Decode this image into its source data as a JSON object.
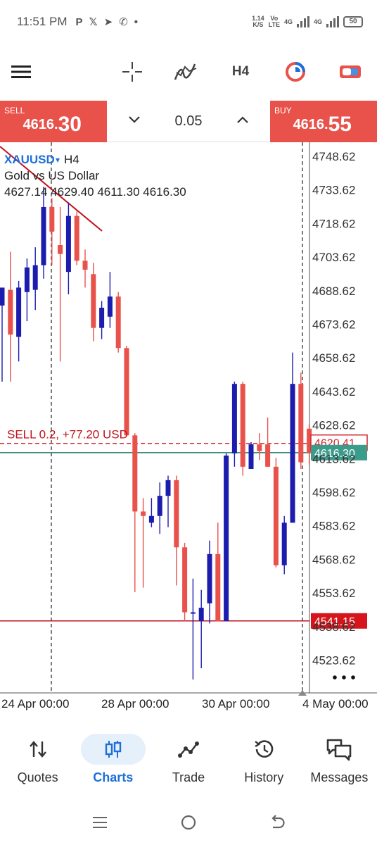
{
  "status_bar": {
    "time": "11:51 PM",
    "speed_value": "1.14",
    "speed_unit": "K/S",
    "vo": "Vo",
    "lte": "LTE",
    "net1": "4G",
    "net2": "4G",
    "battery": "50"
  },
  "toolbar": {
    "timeframe": "H4"
  },
  "trade": {
    "sell_label": "SELL",
    "sell_price_main": "4616.",
    "sell_price_big": "30",
    "buy_label": "BUY",
    "buy_price_main": "4616.",
    "buy_price_big": "55",
    "lot": "0.05"
  },
  "chart_data": {
    "type": "candlestick",
    "symbol": "XAUUSD",
    "timeframe": "H4",
    "description": "Gold vs US Dollar",
    "ohlc_text": "4627.14 4629.40 4611.30 4616.30",
    "y_ticks": [
      "4748.62",
      "4733.62",
      "4718.62",
      "4703.62",
      "4688.62",
      "4673.62",
      "4658.62",
      "4643.62",
      "4628.62",
      "4613.62",
      "4598.62",
      "4583.62",
      "4568.62",
      "4553.62",
      "4538.62",
      "4523.62"
    ],
    "y_range": [
      4514,
      4751
    ],
    "x_labels": [
      "24 Apr 00:00",
      "28 Apr 00:00",
      "30 Apr 00:00",
      "4 May 00:00"
    ],
    "position_label": "SELL 0.2,   +77.20 USD",
    "position_price": 4620.41,
    "position_price_label": "4620.41",
    "current_price": 4616.3,
    "current_price_label": "4616.30",
    "stop_price": 4541.15,
    "stop_price_label": "4541.15",
    "bull_color": "#1c1cae",
    "bear_color": "#e8524a",
    "candles": [
      {
        "o": 4682,
        "h": 4689,
        "l": 4648,
        "c": 4690
      },
      {
        "o": 4689,
        "h": 4706,
        "l": 4648,
        "c": 4669
      },
      {
        "o": 4668,
        "h": 4693,
        "l": 4657,
        "c": 4690
      },
      {
        "o": 4688,
        "h": 4703,
        "l": 4675,
        "c": 4699
      },
      {
        "o": 4689,
        "h": 4708,
        "l": 4680,
        "c": 4700
      },
      {
        "o": 4700,
        "h": 4735,
        "l": 4694,
        "c": 4726
      },
      {
        "o": 4726,
        "h": 4730,
        "l": 4700,
        "c": 4715
      },
      {
        "o": 4709,
        "h": 4726,
        "l": 4657,
        "c": 4705
      },
      {
        "o": 4697,
        "h": 4728,
        "l": 4687,
        "c": 4722
      },
      {
        "o": 4722,
        "h": 4724,
        "l": 4700,
        "c": 4702
      },
      {
        "o": 4702,
        "h": 4707,
        "l": 4690,
        "c": 4698
      },
      {
        "o": 4696,
        "h": 4701,
        "l": 4666,
        "c": 4672
      },
      {
        "o": 4672,
        "h": 4684,
        "l": 4667,
        "c": 4681
      },
      {
        "o": 4677,
        "h": 4697,
        "l": 4672,
        "c": 4686
      },
      {
        "o": 4686,
        "h": 4688,
        "l": 4661,
        "c": 4663
      },
      {
        "o": 4663,
        "h": 4664,
        "l": 4624,
        "c": 4624
      },
      {
        "o": 4624,
        "h": 4625,
        "l": 4554,
        "c": 4590
      },
      {
        "o": 4590,
        "h": 4596,
        "l": 4556,
        "c": 4588
      },
      {
        "o": 4585,
        "h": 4596,
        "l": 4583,
        "c": 4588
      },
      {
        "o": 4588,
        "h": 4603,
        "l": 4580,
        "c": 4597
      },
      {
        "o": 4597,
        "h": 4606,
        "l": 4583,
        "c": 4604
      },
      {
        "o": 4604,
        "h": 4606,
        "l": 4557,
        "c": 4574
      },
      {
        "o": 4574,
        "h": 4576,
        "l": 4541,
        "c": 4545
      },
      {
        "o": 4545,
        "h": 4560,
        "l": 4515,
        "c": 4545
      },
      {
        "o": 4541,
        "h": 4555,
        "l": 4520,
        "c": 4547
      },
      {
        "o": 4549,
        "h": 4577,
        "l": 4540,
        "c": 4571
      },
      {
        "o": 4571,
        "h": 4585,
        "l": 4541,
        "c": 4541
      },
      {
        "o": 4541,
        "h": 4616,
        "l": 4541,
        "c": 4615
      },
      {
        "o": 4616,
        "h": 4648,
        "l": 4610,
        "c": 4647
      },
      {
        "o": 4647,
        "h": 4648,
        "l": 4606,
        "c": 4610
      },
      {
        "o": 4609,
        "h": 4621,
        "l": 4609,
        "c": 4620
      },
      {
        "o": 4620,
        "h": 4625,
        "l": 4613,
        "c": 4617
      },
      {
        "o": 4620,
        "h": 4632,
        "l": 4610,
        "c": 4610
      },
      {
        "o": 4610,
        "h": 4614,
        "l": 4565,
        "c": 4566
      },
      {
        "o": 4566,
        "h": 4588,
        "l": 4562,
        "c": 4585
      },
      {
        "o": 4585,
        "h": 4661,
        "l": 4585,
        "c": 4647
      },
      {
        "o": 4647,
        "h": 4652,
        "l": 4609,
        "c": 4612
      },
      {
        "o": 4627,
        "h": 4629,
        "l": 4611,
        "c": 4616
      }
    ]
  },
  "nav": {
    "items": [
      {
        "label": "Quotes"
      },
      {
        "label": "Charts"
      },
      {
        "label": "Trade"
      },
      {
        "label": "History"
      },
      {
        "label": "Messages"
      }
    ]
  }
}
